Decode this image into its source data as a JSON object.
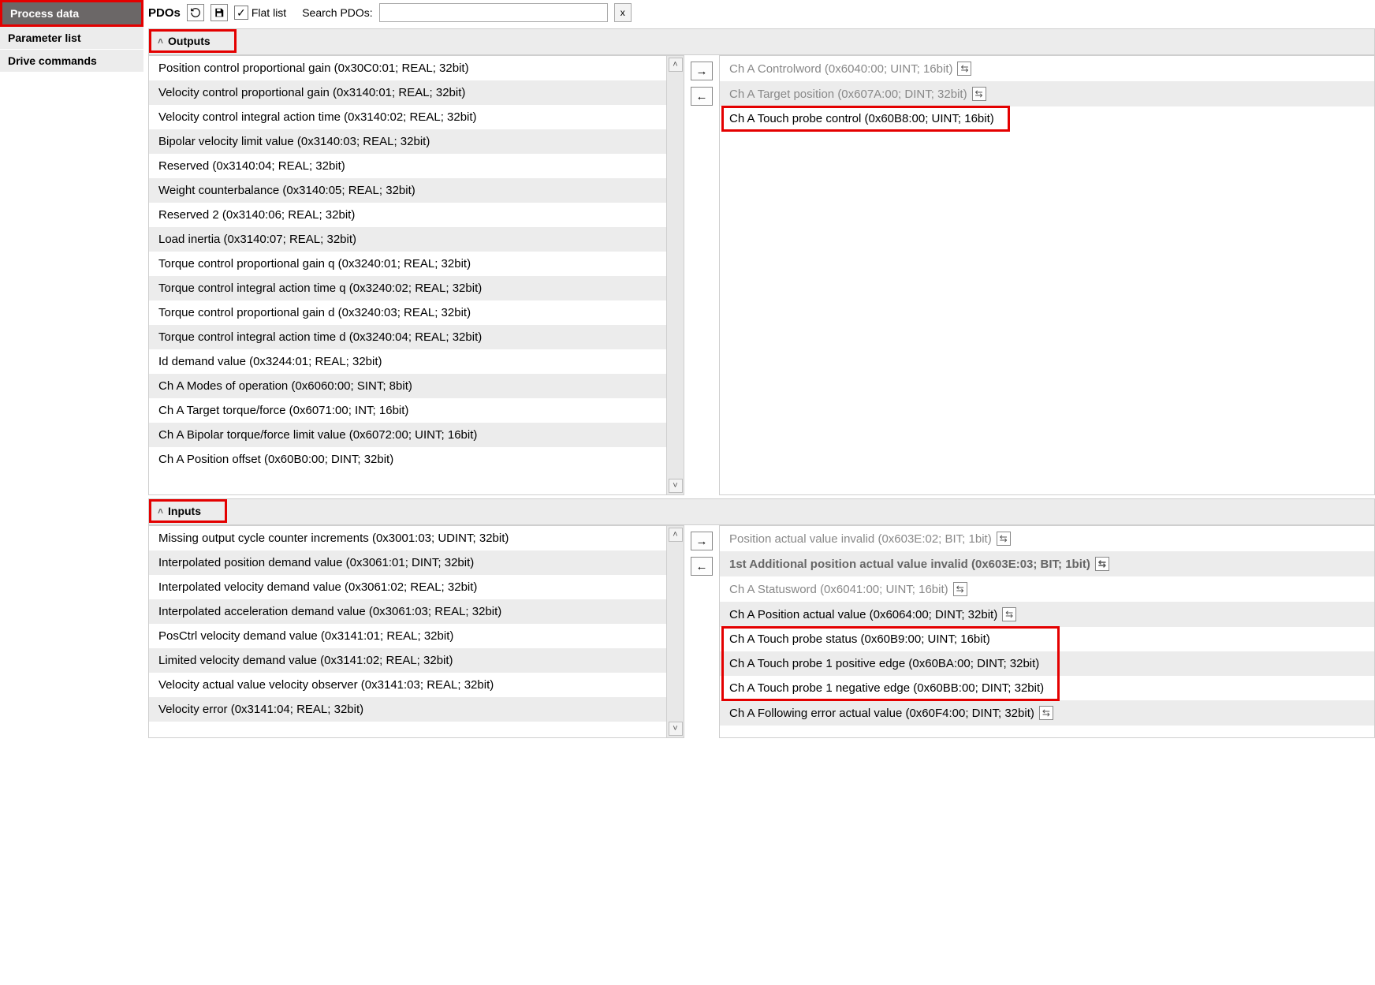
{
  "sidebar": {
    "items": [
      {
        "label": "Process data",
        "active": true
      },
      {
        "label": "Parameter list",
        "active": false
      },
      {
        "label": "Drive commands",
        "active": false
      }
    ]
  },
  "toolbar": {
    "title": "PDOs",
    "flat_label": "Flat list",
    "flat_checked": true,
    "search_label": "Search PDOs:",
    "search_value": "",
    "clear_label": "x"
  },
  "sections": {
    "outputs_label": "Outputs",
    "inputs_label": "Inputs"
  },
  "outputs_left": [
    "Position control proportional gain (0x30C0:01; REAL; 32bit)",
    "Velocity control proportional gain (0x3140:01; REAL; 32bit)",
    "Velocity control integral action time (0x3140:02; REAL; 32bit)",
    "Bipolar velocity limit value (0x3140:03; REAL; 32bit)",
    "Reserved (0x3140:04; REAL; 32bit)",
    "Weight counterbalance (0x3140:05; REAL; 32bit)",
    "Reserved 2 (0x3140:06; REAL; 32bit)",
    "Load inertia (0x3140:07; REAL; 32bit)",
    "Torque control proportional gain q (0x3240:01; REAL; 32bit)",
    "Torque control integral action time q (0x3240:02; REAL; 32bit)",
    "Torque control proportional gain d (0x3240:03; REAL; 32bit)",
    "Torque control integral action time d (0x3240:04; REAL; 32bit)",
    "Id demand value (0x3244:01; REAL; 32bit)",
    "Ch A Modes of operation (0x6060:00; SINT; 8bit)",
    "Ch A Target torque/force (0x6071:00; INT; 16bit)",
    "Ch A Bipolar torque/force limit value (0x6072:00; UINT; 16bit)",
    "Ch A Position offset (0x60B0:00; DINT; 32bit)"
  ],
  "outputs_right": [
    {
      "text": "Ch A Controlword (0x6040:00; UINT; 16bit)",
      "mand": true,
      "swap": true
    },
    {
      "text": "Ch A Target position (0x607A:00; DINT; 32bit)",
      "mand": true,
      "swap": true
    },
    {
      "text": "Ch A Touch probe control (0x60B8:00; UINT; 16bit)",
      "mand": false,
      "swap": false,
      "highlight": true
    }
  ],
  "inputs_left": [
    "Missing output cycle counter increments (0x3001:03; UDINT; 32bit)",
    "Interpolated position demand value (0x3061:01; DINT; 32bit)",
    "Interpolated velocity demand value (0x3061:02; REAL; 32bit)",
    "Interpolated acceleration demand value (0x3061:03; REAL; 32bit)",
    "PosCtrl velocity demand value (0x3141:01; REAL; 32bit)",
    "Limited velocity demand value (0x3141:02; REAL; 32bit)",
    "Velocity actual value velocity observer (0x3141:03; REAL; 32bit)",
    "Velocity error (0x3141:04; REAL; 32bit)"
  ],
  "inputs_right": [
    {
      "text": "Position actual value invalid (0x603E:02; BIT; 1bit)",
      "mand": true,
      "swap": true
    },
    {
      "text": "1st Additional position actual value invalid (0x603E:03; BIT; 1bit)",
      "mand": true,
      "bold": true,
      "swap": true
    },
    {
      "text": "Ch A Statusword (0x6041:00; UINT; 16bit)",
      "mand": true,
      "swap": true
    },
    {
      "text": "Ch A Position actual value (0x6064:00; DINT; 32bit)",
      "mand": false,
      "swap": true
    },
    {
      "text": "Ch A Touch probe status (0x60B9:00; UINT; 16bit)",
      "mand": false,
      "swap": false,
      "hl": "start"
    },
    {
      "text": "Ch A Touch probe 1 positive edge (0x60BA:00; DINT; 32bit)",
      "mand": false,
      "swap": false
    },
    {
      "text": "Ch A Touch probe 1 negative edge (0x60BB:00; DINT; 32bit)",
      "mand": false,
      "swap": false,
      "hl": "end"
    },
    {
      "text": "Ch A Following error actual value (0x60F4:00; DINT; 32bit)",
      "mand": false,
      "swap": true
    }
  ]
}
